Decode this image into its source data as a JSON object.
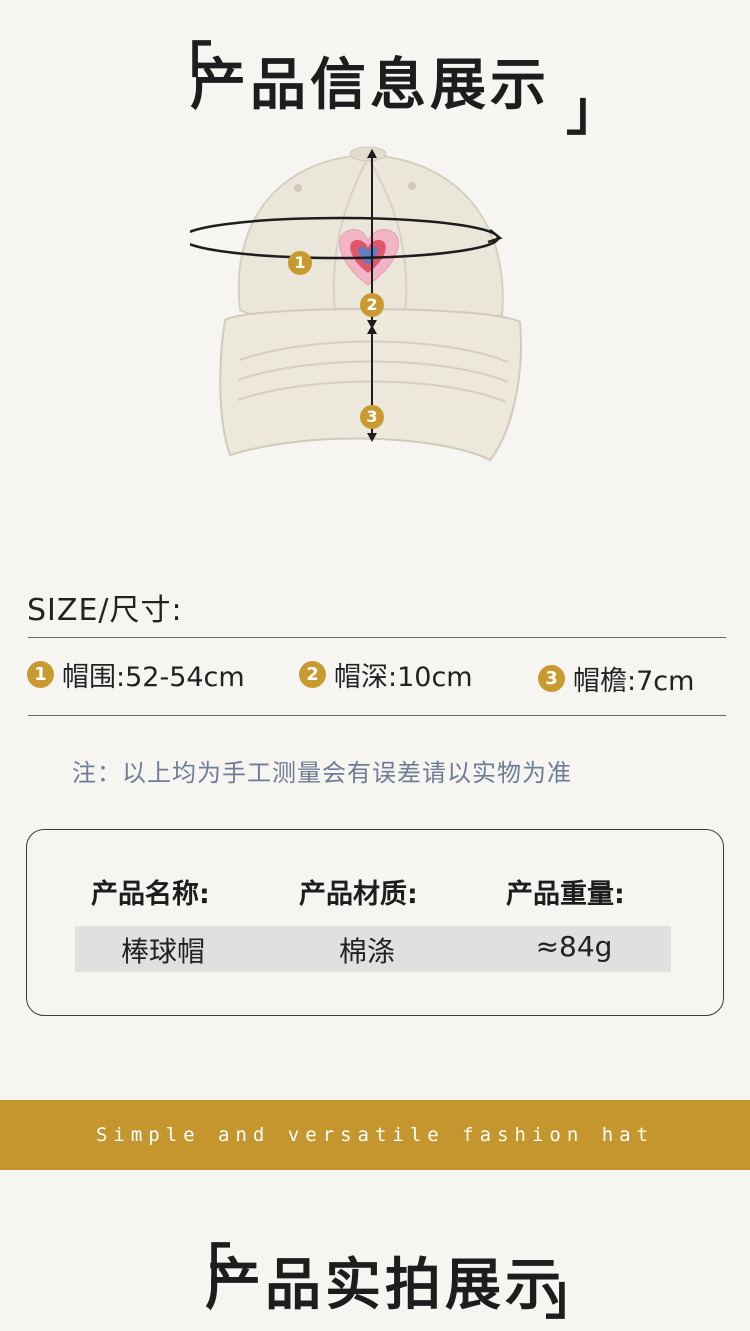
{
  "header": {
    "title": "产品信息展示",
    "bracket_open": "「",
    "bracket_close": "」"
  },
  "diagram": {
    "markers": [
      "1",
      "2",
      "3"
    ],
    "hat_color": "#ebe6da",
    "heart_colors": [
      "#f2b5c6",
      "#e0566a",
      "#5b7fc2"
    ]
  },
  "size": {
    "heading": "SIZE/尺寸:",
    "items": [
      {
        "num": "1",
        "label": "帽围:52-54cm"
      },
      {
        "num": "2",
        "label": "帽深:10cm"
      },
      {
        "num": "3",
        "label": "帽檐:7cm"
      }
    ],
    "note": "注：以上均为手工测量会有误差请以实物为准"
  },
  "info": {
    "headers": [
      "产品名称:",
      "产品材质:",
      "产品重量:"
    ],
    "values": [
      "棒球帽",
      "棉涤",
      "≈84g"
    ]
  },
  "band": {
    "text": "Simple and versatile fashion hat",
    "color": "#c5962e"
  },
  "footer": {
    "title": "产品实拍展示",
    "bracket_open": "「",
    "bracket_close": "」"
  }
}
